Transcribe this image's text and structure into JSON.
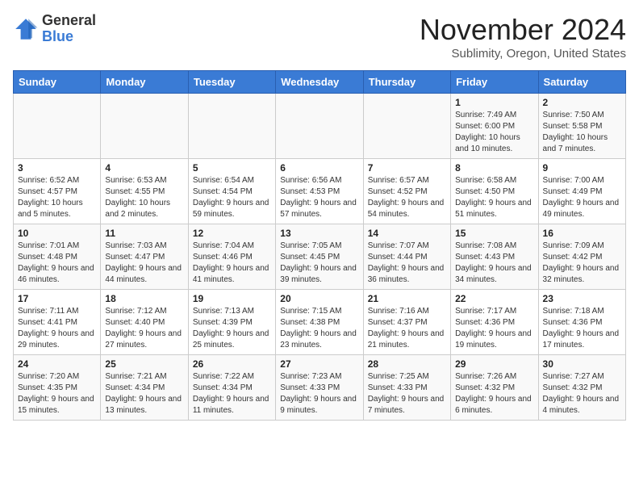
{
  "logo": {
    "general": "General",
    "blue": "Blue"
  },
  "title": "November 2024",
  "subtitle": "Sublimity, Oregon, United States",
  "days_of_week": [
    "Sunday",
    "Monday",
    "Tuesday",
    "Wednesday",
    "Thursday",
    "Friday",
    "Saturday"
  ],
  "weeks": [
    [
      {
        "day": "",
        "info": ""
      },
      {
        "day": "",
        "info": ""
      },
      {
        "day": "",
        "info": ""
      },
      {
        "day": "",
        "info": ""
      },
      {
        "day": "",
        "info": ""
      },
      {
        "day": "1",
        "info": "Sunrise: 7:49 AM\nSunset: 6:00 PM\nDaylight: 10 hours and 10 minutes."
      },
      {
        "day": "2",
        "info": "Sunrise: 7:50 AM\nSunset: 5:58 PM\nDaylight: 10 hours and 7 minutes."
      }
    ],
    [
      {
        "day": "3",
        "info": "Sunrise: 6:52 AM\nSunset: 4:57 PM\nDaylight: 10 hours and 5 minutes."
      },
      {
        "day": "4",
        "info": "Sunrise: 6:53 AM\nSunset: 4:55 PM\nDaylight: 10 hours and 2 minutes."
      },
      {
        "day": "5",
        "info": "Sunrise: 6:54 AM\nSunset: 4:54 PM\nDaylight: 9 hours and 59 minutes."
      },
      {
        "day": "6",
        "info": "Sunrise: 6:56 AM\nSunset: 4:53 PM\nDaylight: 9 hours and 57 minutes."
      },
      {
        "day": "7",
        "info": "Sunrise: 6:57 AM\nSunset: 4:52 PM\nDaylight: 9 hours and 54 minutes."
      },
      {
        "day": "8",
        "info": "Sunrise: 6:58 AM\nSunset: 4:50 PM\nDaylight: 9 hours and 51 minutes."
      },
      {
        "day": "9",
        "info": "Sunrise: 7:00 AM\nSunset: 4:49 PM\nDaylight: 9 hours and 49 minutes."
      }
    ],
    [
      {
        "day": "10",
        "info": "Sunrise: 7:01 AM\nSunset: 4:48 PM\nDaylight: 9 hours and 46 minutes."
      },
      {
        "day": "11",
        "info": "Sunrise: 7:03 AM\nSunset: 4:47 PM\nDaylight: 9 hours and 44 minutes."
      },
      {
        "day": "12",
        "info": "Sunrise: 7:04 AM\nSunset: 4:46 PM\nDaylight: 9 hours and 41 minutes."
      },
      {
        "day": "13",
        "info": "Sunrise: 7:05 AM\nSunset: 4:45 PM\nDaylight: 9 hours and 39 minutes."
      },
      {
        "day": "14",
        "info": "Sunrise: 7:07 AM\nSunset: 4:44 PM\nDaylight: 9 hours and 36 minutes."
      },
      {
        "day": "15",
        "info": "Sunrise: 7:08 AM\nSunset: 4:43 PM\nDaylight: 9 hours and 34 minutes."
      },
      {
        "day": "16",
        "info": "Sunrise: 7:09 AM\nSunset: 4:42 PM\nDaylight: 9 hours and 32 minutes."
      }
    ],
    [
      {
        "day": "17",
        "info": "Sunrise: 7:11 AM\nSunset: 4:41 PM\nDaylight: 9 hours and 29 minutes."
      },
      {
        "day": "18",
        "info": "Sunrise: 7:12 AM\nSunset: 4:40 PM\nDaylight: 9 hours and 27 minutes."
      },
      {
        "day": "19",
        "info": "Sunrise: 7:13 AM\nSunset: 4:39 PM\nDaylight: 9 hours and 25 minutes."
      },
      {
        "day": "20",
        "info": "Sunrise: 7:15 AM\nSunset: 4:38 PM\nDaylight: 9 hours and 23 minutes."
      },
      {
        "day": "21",
        "info": "Sunrise: 7:16 AM\nSunset: 4:37 PM\nDaylight: 9 hours and 21 minutes."
      },
      {
        "day": "22",
        "info": "Sunrise: 7:17 AM\nSunset: 4:36 PM\nDaylight: 9 hours and 19 minutes."
      },
      {
        "day": "23",
        "info": "Sunrise: 7:18 AM\nSunset: 4:36 PM\nDaylight: 9 hours and 17 minutes."
      }
    ],
    [
      {
        "day": "24",
        "info": "Sunrise: 7:20 AM\nSunset: 4:35 PM\nDaylight: 9 hours and 15 minutes."
      },
      {
        "day": "25",
        "info": "Sunrise: 7:21 AM\nSunset: 4:34 PM\nDaylight: 9 hours and 13 minutes."
      },
      {
        "day": "26",
        "info": "Sunrise: 7:22 AM\nSunset: 4:34 PM\nDaylight: 9 hours and 11 minutes."
      },
      {
        "day": "27",
        "info": "Sunrise: 7:23 AM\nSunset: 4:33 PM\nDaylight: 9 hours and 9 minutes."
      },
      {
        "day": "28",
        "info": "Sunrise: 7:25 AM\nSunset: 4:33 PM\nDaylight: 9 hours and 7 minutes."
      },
      {
        "day": "29",
        "info": "Sunrise: 7:26 AM\nSunset: 4:32 PM\nDaylight: 9 hours and 6 minutes."
      },
      {
        "day": "30",
        "info": "Sunrise: 7:27 AM\nSunset: 4:32 PM\nDaylight: 9 hours and 4 minutes."
      }
    ]
  ]
}
